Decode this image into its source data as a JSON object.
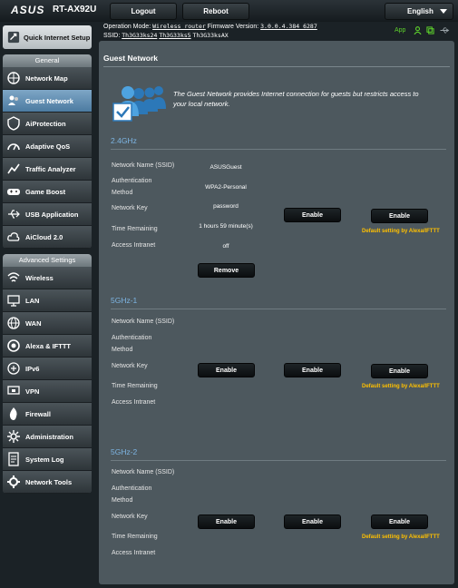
{
  "header": {
    "brand": "ASUS",
    "model": "RT-AX92U",
    "logout": "Logout",
    "reboot": "Reboot",
    "language": "English"
  },
  "info": {
    "op_mode_label": "Operation Mode:",
    "op_mode_value": "Wireless router",
    "fw_label": "Firmware Version:",
    "fw_value": "3.0.0.4.384_6287",
    "ssid_label": "SSID:",
    "ssid1": "Th3G33ks24",
    "ssid2": "Th3G33ks5",
    "ssid3": "Th3G33ksAX",
    "app": "App"
  },
  "sidebar": {
    "quick_setup": "Quick Internet Setup",
    "general_header": "General",
    "general": [
      {
        "label": "Network Map",
        "icon": "network-map-icon"
      },
      {
        "label": "Guest Network",
        "icon": "guest-network-icon"
      },
      {
        "label": "AiProtection",
        "icon": "aiprotection-icon"
      },
      {
        "label": "Adaptive QoS",
        "icon": "adaptive-qos-icon"
      },
      {
        "label": "Traffic Analyzer",
        "icon": "traffic-analyzer-icon"
      },
      {
        "label": "Game Boost",
        "icon": "game-boost-icon"
      },
      {
        "label": "USB Application",
        "icon": "usb-application-icon"
      },
      {
        "label": "AiCloud 2.0",
        "icon": "aicloud-icon"
      }
    ],
    "advanced_header": "Advanced Settings",
    "advanced": [
      {
        "label": "Wireless",
        "icon": "wireless-icon"
      },
      {
        "label": "LAN",
        "icon": "lan-icon"
      },
      {
        "label": "WAN",
        "icon": "wan-icon"
      },
      {
        "label": "Alexa & IFTTT",
        "icon": "alexa-ifttt-icon"
      },
      {
        "label": "IPv6",
        "icon": "ipv6-icon"
      },
      {
        "label": "VPN",
        "icon": "vpn-icon"
      },
      {
        "label": "Firewall",
        "icon": "firewall-icon"
      },
      {
        "label": "Administration",
        "icon": "administration-icon"
      },
      {
        "label": "System Log",
        "icon": "system-log-icon"
      },
      {
        "label": "Network Tools",
        "icon": "network-tools-icon"
      }
    ]
  },
  "main": {
    "title": "Guest Network",
    "intro": "The Guest Network provides Internet connection for guests but restricts access to your local network.",
    "labels": {
      "name": "Network Name (SSID)",
      "auth": "Authentication Method",
      "key": "Network Key",
      "time": "Time Remaining",
      "intranet": "Access Intranet"
    },
    "enable": "Enable",
    "remove": "Remove",
    "alexa_note": "Default setting by Alexa/IFTTT",
    "bands": [
      {
        "name": "2.4GHz",
        "guest1": {
          "ssid": "ASUSGuest",
          "auth": "WPA2-Personal",
          "key": "password",
          "time": "1 hours 59 minute(s)",
          "intranet": "off"
        }
      },
      {
        "name": "5GHz-1"
      },
      {
        "name": "5GHz-2"
      }
    ]
  }
}
